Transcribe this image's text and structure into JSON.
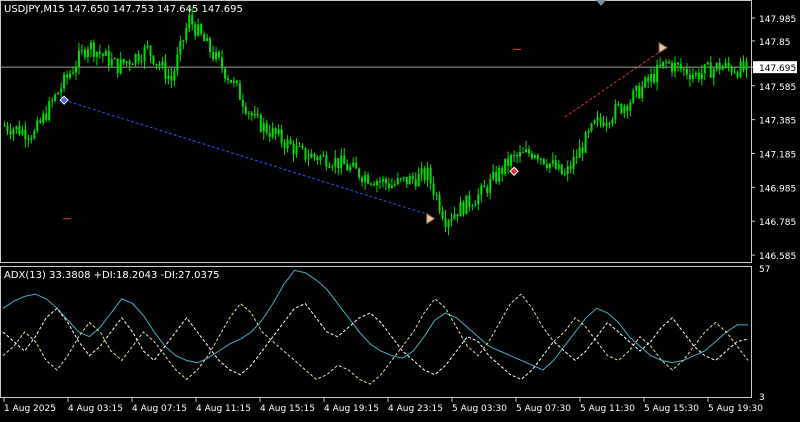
{
  "main_header": "USDJPY,M15  147.650 147.753 147.645 147.695",
  "indicator_header": "ADX(13) 33.3808 +DI:18.2043 -DI:27.0375",
  "colors": {
    "background": "#000000",
    "frame": "#c8c8c8",
    "bull": "#00e000",
    "bear": "#00e000",
    "price_line": "#a0a0a0",
    "text": "#ffffff",
    "trend_down": "#3050ff",
    "trend_up": "#e03030",
    "adx": "#40b0c0",
    "plus_di": "#e0e0a0",
    "minus_di": "#ffffff",
    "marker_red": "#e03030",
    "marker_arrow": "#f0c8a0"
  },
  "chart_data": [
    {
      "type": "candlestick",
      "symbol": "USDJPY",
      "timeframe": "M15",
      "title": "USDJPY,M15  147.650 147.753 147.645 147.695",
      "ylim": [
        146.55,
        148.08
      ],
      "y_ticks": [
        147.985,
        147.85,
        147.695,
        147.585,
        147.385,
        147.185,
        146.985,
        146.785,
        146.585
      ],
      "current_price": 147.695,
      "x_ticks": [
        "1 Aug 2025",
        "4 Aug 03:15",
        "4 Aug 07:15",
        "4 Aug 11:15",
        "4 Aug 15:15",
        "4 Aug 19:15",
        "4 Aug 23:15",
        "5 Aug 03:30",
        "5 Aug 07:30",
        "5 Aug 11:30",
        "5 Aug 15:30",
        "5 Aug 19:30"
      ],
      "candle_count": 250,
      "anchors": [
        [
          0,
          147.35
        ],
        [
          10,
          147.3
        ],
        [
          18,
          147.55
        ],
        [
          28,
          147.83
        ],
        [
          38,
          147.7
        ],
        [
          48,
          147.8
        ],
        [
          56,
          147.62
        ],
        [
          62,
          147.98
        ],
        [
          68,
          147.82
        ],
        [
          76,
          147.62
        ],
        [
          84,
          147.38
        ],
        [
          92,
          147.28
        ],
        [
          100,
          147.18
        ],
        [
          110,
          147.15
        ],
        [
          120,
          147.06
        ],
        [
          130,
          147.0
        ],
        [
          142,
          147.06
        ],
        [
          148,
          146.8
        ],
        [
          160,
          146.95
        ],
        [
          170,
          147.15
        ],
        [
          178,
          147.2
        ],
        [
          188,
          147.05
        ],
        [
          198,
          147.35
        ],
        [
          210,
          147.5
        ],
        [
          222,
          147.72
        ],
        [
          232,
          147.65
        ],
        [
          240,
          147.7
        ],
        [
          248,
          147.68
        ]
      ],
      "trend_lines": [
        {
          "color": "blue",
          "from": [
            20,
            147.5
          ],
          "to": [
            143,
            146.82
          ]
        },
        {
          "color": "red",
          "from": [
            188,
            147.4
          ],
          "to": [
            221,
            147.8
          ]
        }
      ],
      "markers": [
        {
          "type": "diamond",
          "color": "blue",
          "x": 20,
          "y": 147.5
        },
        {
          "type": "arrow",
          "color": "tan",
          "x": 143,
          "y": 146.8
        },
        {
          "type": "diamond",
          "color": "red",
          "x": 171,
          "y": 147.08
        },
        {
          "type": "arrow",
          "color": "tan",
          "x": 221,
          "y": 147.81
        },
        {
          "type": "dash",
          "color": "red",
          "x": 21,
          "y": 146.8
        },
        {
          "type": "dash",
          "color": "red",
          "x": 172,
          "y": 147.8
        }
      ]
    },
    {
      "type": "line",
      "title": "ADX(13) 33.3808 +DI:18.2043 -DI:27.0375",
      "ylim": [
        3,
        57
      ],
      "y_ticks": [
        57,
        3
      ],
      "series": [
        {
          "name": "ADX",
          "values": [
            40,
            43,
            45,
            46,
            44,
            40,
            35,
            30,
            28,
            32,
            38,
            44,
            42,
            37,
            30,
            24,
            20,
            18,
            17,
            19,
            22,
            25,
            27,
            30,
            35,
            42,
            50,
            56,
            55,
            52,
            48,
            42,
            36,
            30,
            25,
            22,
            20,
            19,
            22,
            28,
            35,
            38,
            36,
            32,
            28,
            24,
            22,
            20,
            18,
            16,
            14,
            18,
            24,
            30,
            36,
            40,
            38,
            34,
            28,
            24,
            20,
            18,
            17,
            18,
            20,
            22,
            26,
            30,
            33,
            33
          ]
        },
        {
          "name": "+DI",
          "values": [
            20,
            24,
            30,
            26,
            18,
            14,
            20,
            28,
            34,
            30,
            22,
            18,
            24,
            30,
            26,
            20,
            14,
            10,
            14,
            20,
            28,
            36,
            42,
            38,
            30,
            26,
            22,
            18,
            14,
            10,
            12,
            16,
            14,
            10,
            8,
            12,
            18,
            24,
            30,
            38,
            44,
            40,
            32,
            24,
            20,
            26,
            34,
            42,
            46,
            40,
            32,
            26,
            30,
            36,
            32,
            26,
            20,
            18,
            22,
            28,
            24,
            18,
            14,
            18,
            24,
            30,
            34,
            30,
            24,
            18
          ]
        },
        {
          "name": "-DI",
          "values": [
            30,
            26,
            22,
            28,
            36,
            40,
            34,
            26,
            20,
            24,
            30,
            36,
            30,
            22,
            18,
            24,
            30,
            36,
            30,
            24,
            18,
            14,
            12,
            16,
            22,
            28,
            34,
            40,
            42,
            36,
            30,
            28,
            32,
            36,
            38,
            34,
            28,
            22,
            18,
            14,
            12,
            16,
            22,
            28,
            26,
            20,
            16,
            12,
            10,
            14,
            20,
            26,
            22,
            18,
            22,
            28,
            34,
            30,
            26,
            22,
            26,
            32,
            36,
            30,
            24,
            20,
            18,
            22,
            26,
            27
          ]
        }
      ]
    }
  ]
}
